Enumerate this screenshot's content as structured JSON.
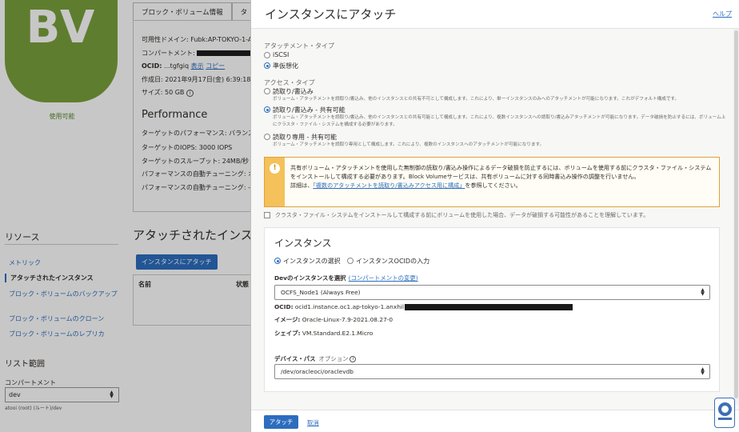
{
  "background": {
    "logo_text": "BV",
    "status": "使用可能",
    "tabs": [
      "ブロック・ボリューム情報",
      "タ"
    ],
    "info": {
      "domain": "可用性ドメイン: Fubk:AP-TOKYO-1-A",
      "compartment_label": "コンパートメント:",
      "ocid_label": "OCID:",
      "ocid_value": "...tgfgiq",
      "ocid_show": "表示",
      "ocid_copy": "コピー",
      "created": "作成日: 2021年9月17日(金) 6:39:18 UT",
      "size": "サイズ: 50 GB"
    },
    "performance_title": "Performance",
    "performance_lines": [
      "ターゲットのパフォーマンス: バランス",
      "ターゲットのIOPS: 3000 IOPS",
      "ターゲットのスループット: 24MB/秒",
      "パフォーマンスの自動チューニング: オ",
      "パフォーマンスの自動チューニング: -"
    ],
    "resources_title": "リソース",
    "nav": [
      "メトリック",
      "アタッチされたインスタンス",
      "ブロック・ボリュームのバックアップ",
      "ブロック・ボリュームのクローン",
      "ブロック・ボリュームのレプリカ"
    ],
    "scope_title": "リスト範囲",
    "compartment_label": "コンパートメント",
    "compartment_value": "dev",
    "compartment_hint": "atooi (root) (ルート)/dev",
    "attached_title": "アタッチされたインスタンス",
    "attach_button": "インスタンスにアタッチ",
    "table_headers": [
      "名前",
      "状態"
    ]
  },
  "dialog": {
    "title": "インスタンスにアタッチ",
    "help": "ヘルプ",
    "attachment_type_label": "アタッチメント・タイプ",
    "attachment_types": [
      {
        "label": "iSCSI",
        "selected": false
      },
      {
        "label": "準仮想化",
        "selected": true
      }
    ],
    "access_type_label": "アクセス・タイプ",
    "access_types": [
      {
        "label": "読取り/書込み",
        "selected": false,
        "desc": "ボリューム・アタッチメントを読取り/書込み、他のインスタンスとの共有不可として構成します。これにより、単一インスタンスのみへのアタッチメントが可能になります。これがデフォルト構成です。"
      },
      {
        "label": "読取り/書込み - 共有可能",
        "selected": true,
        "desc": "ボリューム・アタッチメントを読取り/書込み、他のインスタンスとの共有可能として構成します。これにより、複数インスタンスへの読取り/書込みアタッチメントが可能になります。データ破損を防止するには、ボリューム上にクラスタ・ファイル・システムを構成する必要があります。"
      },
      {
        "label": "読取り専用 - 共有可能",
        "selected": false,
        "desc": "ボリューム・アタッチメントを読取り専用として構成します。これにより、複数のインスタンスへのアタッチメントが可能になります。"
      }
    ],
    "warning": {
      "text": "共有ボリューム・アタッチメントを使用した無制御の読取り/書込み操作によるデータ破損を防止するには、ボリュームを使用する前にクラスタ・ファイル・システムをインストールして構成する必要があります。Block Volumeサービスは、共有ボリュームに対する同時書込み操作の調整を行いません。",
      "detail_prefix": "詳細は、",
      "detail_link": "「複数のアタッチメントを読取り/書込みアクセス用に構成」",
      "detail_suffix": "を参照してください。"
    },
    "acknowledge": "クラスタ・ファイル・システムをインストールして構成する前にボリュームを使用した場合、データが破損する可能性があることを理解しています。",
    "instance_section": {
      "title": "インスタンス",
      "modes": [
        {
          "label": "インスタンスの選択",
          "selected": true
        },
        {
          "label": "インスタンスOCIDの入力",
          "selected": false
        }
      ],
      "select_label": "Devのインスタンスを選択",
      "change_compartment": "(コンパートメントの変更)",
      "selected_instance": "OCFS_Node1 (Always Free)",
      "ocid_label": "OCID:",
      "ocid_value": "ocid1.instance.oc1.ap-tokyo-1.anxhil",
      "image_label": "イメージ:",
      "image_value": "Oracle-Linux-7.9-2021.08.27-0",
      "shape_label": "シェイプ:",
      "shape_value": "VM.Standard.E2.1.Micro",
      "device_path_label": "デバイス・パス",
      "device_path_optional": "オプション",
      "device_path_value": "/dev/oracleoci/oraclevdb"
    },
    "attach_button": "アタッチ",
    "cancel_link": "取消"
  }
}
